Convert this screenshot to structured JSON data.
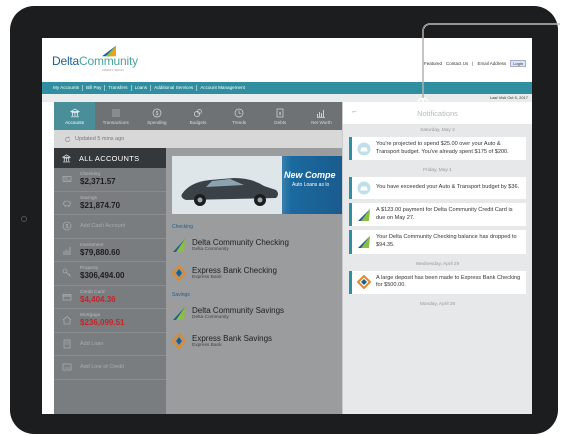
{
  "header": {
    "logo_main": "Delta",
    "logo_accent": "Community",
    "logo_sub": "CREDIT UNION",
    "links": [
      "Featured",
      "Contact Us",
      "|",
      "Email Address"
    ],
    "login_label": "Login"
  },
  "nav": {
    "items": [
      "My Accounts",
      "Bill Pay",
      "Transfers",
      "Loans",
      "Additional Services",
      "Account Management"
    ]
  },
  "last_visit": "Last Visit Oct 5, 2017",
  "tabs": [
    {
      "label": "Accounts",
      "icon": "bank-icon"
    },
    {
      "label": "Transactions",
      "icon": "list-icon"
    },
    {
      "label": "Spending",
      "icon": "dollar-circle-icon"
    },
    {
      "label": "Budgets",
      "icon": "coins-icon"
    },
    {
      "label": "Trends",
      "icon": "clock-icon"
    },
    {
      "label": "Debts",
      "icon": "document-dollar-icon"
    },
    {
      "label": "Net Worth",
      "icon": "bar-chart-icon"
    }
  ],
  "updated": "Updated 5 mins ago",
  "sidebar": {
    "all_accounts": "ALL ACCOUNTS",
    "rows": [
      {
        "label": "Checking",
        "value": "$2,371.57",
        "icon": "checkbook-icon"
      },
      {
        "label": "Savings",
        "value": "$21,874.70",
        "icon": "piggy-bank-icon"
      },
      {
        "action": "Add Cash Account",
        "icon": "dollar-circle-icon"
      },
      {
        "label": "Investment",
        "value": "$79,880.60",
        "icon": "growth-chart-icon"
      },
      {
        "label": "Property",
        "value": "$306,494.00",
        "icon": "key-icon"
      },
      {
        "label": "Credit Card",
        "value": "$4,404.36",
        "icon": "credit-card-icon"
      },
      {
        "label": "Mortgage",
        "value": "$236,099.51",
        "icon": "house-icon"
      },
      {
        "action": "Add Loan",
        "icon": "loan-document-icon"
      },
      {
        "action": "Add Line of Credit",
        "icon": "credit-line-icon"
      }
    ]
  },
  "banner": {
    "title": "New Compe",
    "subtitle": "Auto Loans as lo"
  },
  "checking": {
    "section_label": "Checking",
    "items": [
      {
        "name": "Delta Community Checking",
        "institution": "Delta Community"
      },
      {
        "name": "Express Bank Checking",
        "institution": "Express Bank"
      }
    ]
  },
  "savings": {
    "section_label": "Savings",
    "items": [
      {
        "name": "Delta Community Savings",
        "institution": "Delta Community"
      },
      {
        "name": "Express Bank Savings",
        "institution": "Express Bank"
      }
    ]
  },
  "notifications": {
    "title": "Notifications",
    "back_icon": "back-arrow-icon",
    "dates": [
      "Saturday, May 2",
      "Friday, May 1",
      "Wednesday, April 29",
      "Monday, April 26"
    ],
    "cards": [
      {
        "text": "You're projected to spend $25.00 over your Auto & Transport budget. You've already spent $175 of $200.",
        "icon": "car-icon"
      },
      {
        "text": "You have exceeded your Auto & Transport budget by $36.",
        "icon": "car-icon"
      },
      {
        "text": "A $123.00 payment for Delta Community Credit Card is due on May 27.",
        "icon": "delta-logo-icon"
      },
      {
        "text": "Your Delta Community Checking balance has dropped to $94.35.",
        "icon": "delta-logo-icon"
      },
      {
        "text": "A large deposit has been made to Express Bank Checking for $500.00.",
        "icon": "express-bank-icon"
      }
    ]
  },
  "colors": {
    "teal": "#2f8fa0",
    "dark_panel": "#34383b",
    "negative": "#c0262c"
  }
}
